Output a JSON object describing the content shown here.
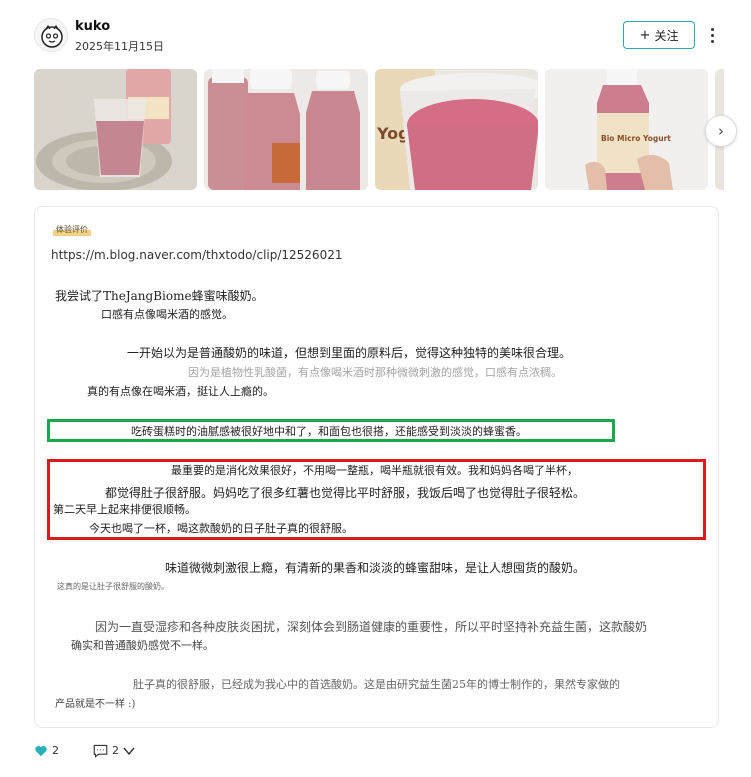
{
  "author": {
    "name": "kuko",
    "date": "2025年11月15日"
  },
  "header": {
    "follow_plus": "+",
    "follow_label": "关注"
  },
  "gallery": {
    "images": [
      {
        "label": "",
        "alt": "glass of pink yogurt on round mat with bottle"
      },
      {
        "label": "",
        "alt": "three pink yogurt bottles"
      },
      {
        "label": "Yog",
        "alt": "glass of pink yogurt in front of bottle"
      },
      {
        "label": "Bio Micro Yogurt",
        "alt": "hand holding bottle of Bio Micro Yogurt"
      }
    ],
    "bottle_brand": "Bio Micro Yogurt",
    "next_glyph": "›"
  },
  "review": {
    "tag": "体验评价",
    "url": "https://m.blog.naver.com/thxtodo/clip/12526021",
    "lines": [
      "我尝试了TheJangBiome蜂蜜味酸奶。",
      "口感有点像喝米酒的感觉。",
      "一开始以为是普通酸奶的味道，但想到里面的原料后，觉得这种独特的美味很合理。",
      "因为是植物性乳酸菌，有点像喝米酒时那种微微刺激的感觉，口感有点浓稠。",
      "真的有点像在喝米酒，挺让人上瘾的。",
      "吃砖蛋糕时的油腻感被很好地中和了，和面包也很搭，还能感受到淡淡的蜂蜜香。",
      "最重要的是消化效果很好，不用喝一整瓶，喝半瓶就很有效。我和妈妈各喝了半杯，",
      "都觉得肚子很舒服。妈妈吃了很多红薯也觉得比平时舒服，我饭后喝了也觉得肚子很轻松。",
      "第二天早上起来排便很顺畅。",
      "今天也喝了一杯，喝这款酸奶的日子肚子真的很舒服。",
      "味道微微刺激很上瘾，有清新的果香和淡淡的蜂蜜甜味，是让人想囤货的酸奶。",
      "这真的是让肚子很舒服的酸奶。",
      "因为一直受湿疹和各种皮肤炎困扰，深刻体会到肠道健康的重要性，所以平时坚持补充益生菌，这款酸奶",
      "确实和普通酸奶感觉不一样。",
      "肚子真的很舒服，已经成为我心中的首选酸奶。这是由研究益生菌25年的博士制作的，果然专家做的",
      "产品就是不一样 :)"
    ]
  },
  "footer": {
    "likes": "2",
    "comments": "2"
  },
  "colors": {
    "accent": "#2aa8b3",
    "highlight_green": "#1aa64a",
    "highlight_red": "#d81c1c",
    "heart": "#2ab0bd"
  }
}
